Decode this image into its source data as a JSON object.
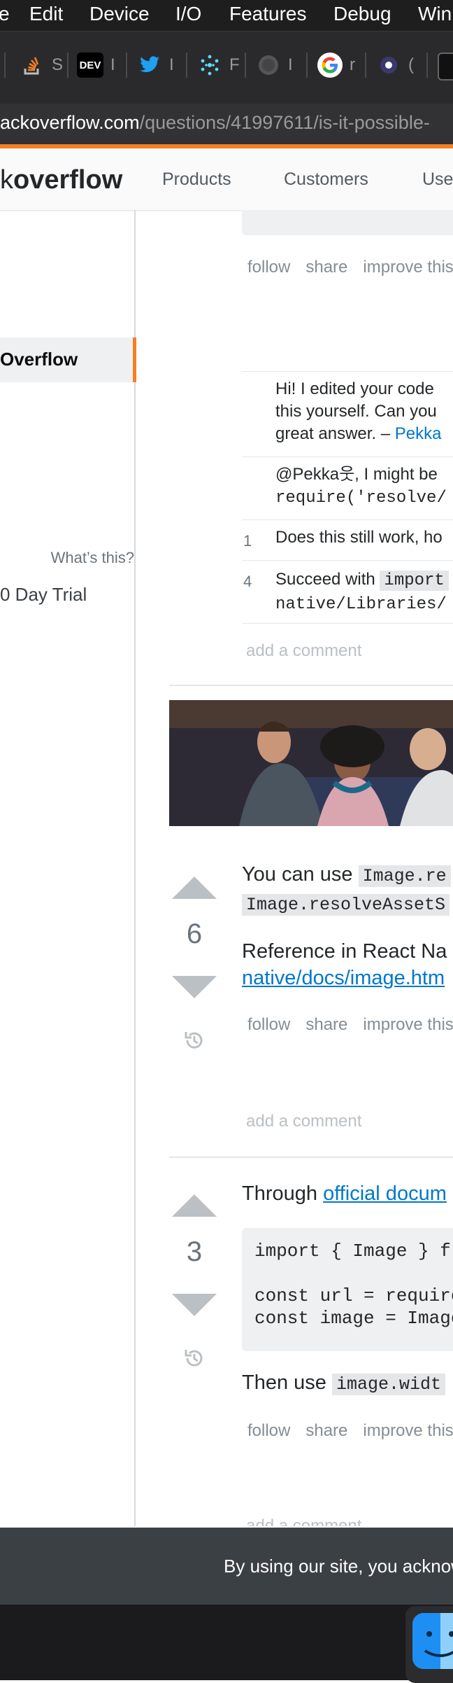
{
  "menubar": {
    "items": [
      "e",
      "Edit",
      "Device",
      "I/O",
      "Features",
      "Debug",
      "Win"
    ]
  },
  "bookmarks": [
    {
      "icon": "stackoverflow-icon",
      "label": "S"
    },
    {
      "icon": "dev-icon",
      "badge": "DEV",
      "label": "I"
    },
    {
      "icon": "twitter-icon",
      "label": "I"
    },
    {
      "icon": "react-icon",
      "label": "F"
    },
    {
      "icon": "globe-icon",
      "label": "I"
    },
    {
      "icon": "google-icon",
      "label": "r"
    },
    {
      "icon": "bookmark-icon",
      "label": "("
    }
  ],
  "address": {
    "host": "ackoverflow.com",
    "path": "/questions/41997611/is-it-possible-"
  },
  "header": {
    "logo_light": "k",
    "logo_bold": "overflow",
    "nav": [
      "Products",
      "Customers",
      "Use"
    ]
  },
  "sidebar": {
    "active_label": "Overflow",
    "whats_this": "What’s this?",
    "trial": "0 Day Trial"
  },
  "question": {
    "menu": [
      "follow",
      "share",
      "improve this"
    ],
    "comments": [
      {
        "score": "",
        "lines": [
          "Hi! I edited your code",
          "this yourself. Can you",
          "great answer. – "
        ],
        "link": "Pekka"
      },
      {
        "score": "",
        "lines": [
          "@Pekka웃, I might be"
        ],
        "code": "require('resolve/"
      },
      {
        "score": "1",
        "lines": [
          "Does this still work, ho"
        ]
      },
      {
        "score": "4",
        "lead": "Succeed with",
        "code1": "import",
        "code2": "native/Libraries/"
      }
    ],
    "add_comment": "add a comment"
  },
  "answers": [
    {
      "votes": "6",
      "p1_lead": "You can use",
      "p1_code1": "Image.re",
      "p1_code2": "Image.resolveAssetS",
      "p2_lead": "Reference in React Na",
      "p2_link": "native/docs/image.htm",
      "menu": [
        "follow",
        "share",
        "improve this"
      ],
      "add_comment": "add a comment"
    },
    {
      "votes": "3",
      "p1_lead": "Through ",
      "p1_link": "official docum",
      "code": [
        "import { Image } f",
        "",
        "const url = require",
        "const image = Image"
      ],
      "p2_lead": "Then use",
      "p2_code": "image.widt",
      "menu": [
        "follow",
        "share",
        "improve this"
      ],
      "add_comment": "add a comment"
    }
  ],
  "cookie": {
    "text": "By using our site, you acknow"
  },
  "colors": {
    "accent": "#f48024",
    "link": "#0077cc",
    "vote": "#bbc0c4"
  }
}
